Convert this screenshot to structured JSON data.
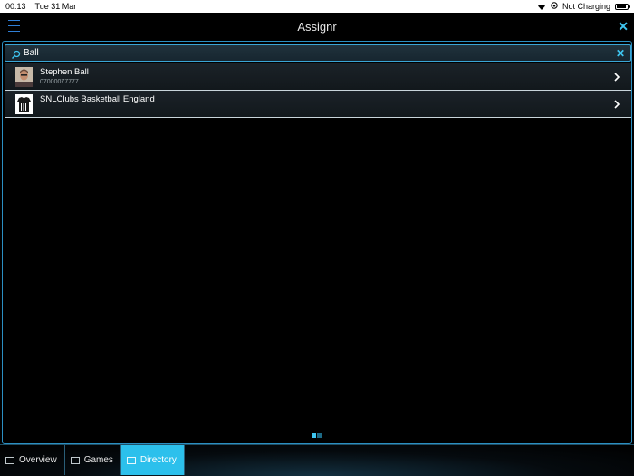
{
  "status_bar": {
    "time": "00:13",
    "date": "Tue 31 Mar",
    "charging": "Not Charging"
  },
  "header": {
    "title": "Assignr",
    "menu_icon": "hamburger-icon",
    "close_icon": "close-icon"
  },
  "search": {
    "value": "Ball",
    "icon": "search-icon",
    "clear_icon": "clear-icon"
  },
  "results": [
    {
      "name": "Stephen Ball",
      "subtitle": "07000077777",
      "icon": "person-avatar"
    },
    {
      "name": "SNLClubs Basketball England",
      "subtitle": "",
      "icon": "jersey-icon"
    }
  ],
  "pager": {
    "pages": 2,
    "current": 1
  },
  "tabs": [
    {
      "label": "Overview",
      "icon": "overview-icon",
      "active": false
    },
    {
      "label": "Games",
      "icon": "games-icon",
      "active": false
    },
    {
      "label": "Directory",
      "icon": "directory-icon",
      "active": true
    }
  ],
  "colors": {
    "accent": "#2cc0ec",
    "border": "#2b8fc2",
    "menu": "#2f7fd6"
  }
}
